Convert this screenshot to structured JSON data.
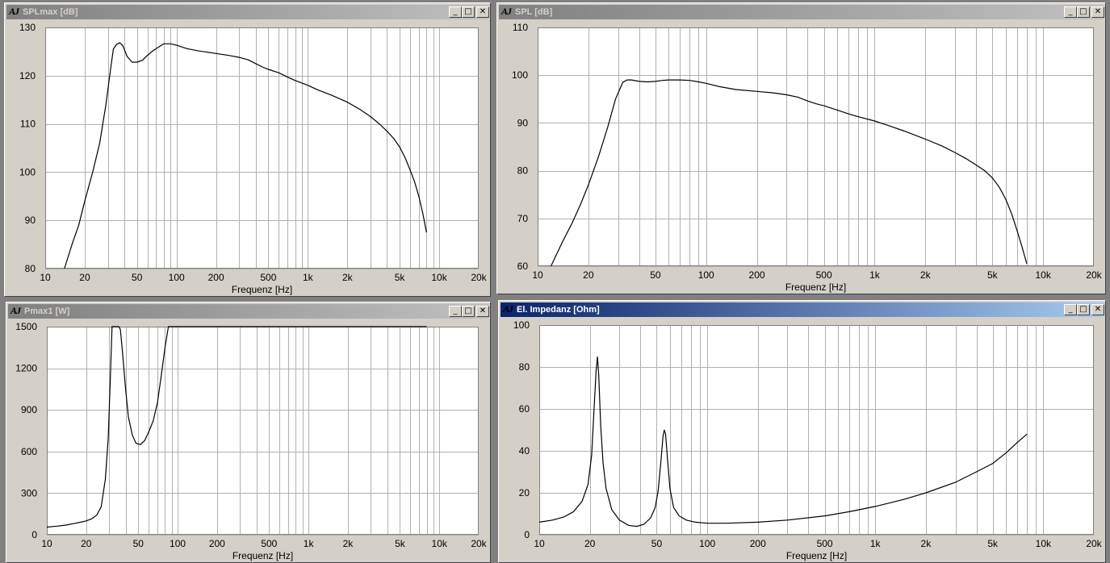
{
  "windows": [
    {
      "id": "splmax",
      "title": "SPLmax [dB]",
      "active": false,
      "buttons": {
        "minimize": "_",
        "maximize": "□",
        "close": "✕"
      },
      "chart_data": {
        "type": "line",
        "xscale": "log",
        "xlim": [
          10,
          20000
        ],
        "ylim": [
          80,
          130
        ],
        "xticks": [
          10,
          20,
          50,
          100,
          200,
          500,
          1000,
          2000,
          5000,
          10000,
          20000
        ],
        "xtick_labels": [
          "10",
          "20",
          "50",
          "100",
          "200",
          "500",
          "1k",
          "2k",
          "5k",
          "10k",
          "20k"
        ],
        "yticks": [
          80,
          90,
          100,
          110,
          120,
          130
        ],
        "ytick_labels": [
          "80",
          "90",
          "100",
          "110",
          "120",
          "130"
        ],
        "xlabel": "Frequenz [Hz]",
        "ylabel": "",
        "grid": true,
        "series": [
          {
            "x": [
              14,
              16,
              18,
              20,
              23,
              26,
              29,
              31,
              33,
              35,
              37,
              39,
              42,
              46,
              50,
              55,
              60,
              65,
              70,
              80,
              90,
              100,
              120,
              150,
              200,
              250,
              300,
              350,
              400,
              450,
              500,
              600,
              700,
              800,
              1000,
              1200,
              1500,
              2000,
              2500,
              3000,
              3500,
              4000,
              4500,
              5000,
              5500,
              6000,
              6500,
              7000,
              7500,
              8000
            ],
            "y": [
              80,
              85,
              89,
              94,
              100,
              106,
              114,
              120,
              125.5,
              126.5,
              126.8,
              126.2,
              124,
              122.8,
              122.8,
              123.2,
              124.2,
              125,
              125.6,
              126.6,
              126.6,
              126.3,
              125.6,
              125.1,
              124.6,
              124.2,
              123.8,
              123.3,
              122.5,
              121.8,
              121.3,
              120.6,
              119.7,
              119,
              118,
              117,
              116,
              114.5,
              113,
              111.5,
              110,
              108.5,
              107,
              105.2,
              103,
              100.5,
              98,
              95,
              91.5,
              87.5
            ]
          }
        ]
      }
    },
    {
      "id": "spl",
      "title": "SPL [dB]",
      "active": false,
      "buttons": {
        "minimize": "_",
        "maximize": "□",
        "close": "✕"
      },
      "chart_data": {
        "type": "line",
        "xscale": "log",
        "xlim": [
          10,
          20000
        ],
        "ylim": [
          60,
          110
        ],
        "xticks": [
          10,
          20,
          50,
          100,
          200,
          500,
          1000,
          2000,
          5000,
          10000,
          20000
        ],
        "xtick_labels": [
          "10",
          "20",
          "50",
          "100",
          "200",
          "500",
          "1k",
          "2k",
          "5k",
          "10k",
          "20k"
        ],
        "yticks": [
          60,
          70,
          80,
          90,
          100,
          110
        ],
        "ytick_labels": [
          "60",
          "70",
          "80",
          "90",
          "100",
          "110"
        ],
        "xlabel": "Frequenz [Hz]",
        "ylabel": "",
        "grid": true,
        "series": [
          {
            "x": [
              12,
              14,
              16,
              18,
              20,
              23,
              26,
              29,
              32,
              34,
              36,
              40,
              45,
              50,
              55,
              60,
              70,
              80,
              90,
              100,
              120,
              150,
              200,
              250,
              300,
              350,
              400,
              450,
              500,
              600,
              700,
              800,
              1000,
              1200,
              1500,
              2000,
              2500,
              3000,
              3500,
              4000,
              4500,
              5000,
              5500,
              6000,
              6500,
              7000,
              7500,
              8000
            ],
            "y": [
              60,
              65,
              69,
              73,
              77,
              83,
              89,
              95,
              98.5,
              99,
              99,
              98.7,
              98.6,
              98.7,
              98.9,
              99,
              99,
              98.9,
              98.6,
              98.3,
              97.6,
              97,
              96.6,
              96.3,
              95.9,
              95.4,
              94.6,
              94,
              93.6,
              92.7,
              91.9,
              91.3,
              90.4,
              89.5,
              88.3,
              86.6,
              85.2,
              83.8,
              82.5,
              81.2,
              80,
              78.5,
              76.5,
              74,
              71,
              67.5,
              64,
              60.5
            ]
          }
        ]
      }
    },
    {
      "id": "pmax",
      "title": "Pmax1 [W]",
      "active": false,
      "buttons": {
        "minimize": "_",
        "maximize": "□",
        "close": "✕"
      },
      "chart_data": {
        "type": "line",
        "xscale": "log",
        "xlim": [
          10,
          20000
        ],
        "ylim": [
          0,
          1500
        ],
        "xticks": [
          10,
          20,
          50,
          100,
          200,
          500,
          1000,
          2000,
          5000,
          10000,
          20000
        ],
        "xtick_labels": [
          "10",
          "20",
          "50",
          "100",
          "200",
          "500",
          "1k",
          "2k",
          "5k",
          "10k",
          "20k"
        ],
        "yticks": [
          0,
          300,
          600,
          900,
          1200,
          1500
        ],
        "ytick_labels": [
          "0",
          "300",
          "600",
          "900",
          "1200",
          "1500"
        ],
        "xlabel": "Frequenz [Hz]",
        "ylabel": "",
        "grid": true,
        "series": [
          {
            "x": [
              10,
              12,
              14,
              16,
              18,
              20,
              22,
              24,
              26,
              28,
              29.5,
              30.5,
              31.5,
              32.5,
              33.5,
              34.5,
              35.5,
              36.5,
              38,
              40,
              42,
              45,
              48,
              52,
              56,
              60,
              65,
              70,
              75,
              80,
              85,
              90,
              100,
              200,
              500,
              1000,
              2000,
              5000,
              8000
            ],
            "y": [
              55,
              62,
              70,
              80,
              90,
              100,
              115,
              140,
              200,
              400,
              700,
              1100,
              1500,
              1500,
              1500,
              1500,
              1500,
              1480,
              1300,
              1050,
              850,
              720,
              660,
              650,
              680,
              740,
              820,
              950,
              1150,
              1350,
              1500,
              1500,
              1500,
              1500,
              1500,
              1500,
              1500,
              1500,
              1500
            ]
          }
        ]
      }
    },
    {
      "id": "impedance",
      "title": "El. Impedanz [Ohm]",
      "active": true,
      "buttons": {
        "minimize": "_",
        "maximize": "□",
        "close": "✕"
      },
      "chart_data": {
        "type": "line",
        "xscale": "log",
        "xlim": [
          10,
          20000
        ],
        "ylim": [
          0,
          100
        ],
        "xticks": [
          10,
          20,
          50,
          100,
          200,
          500,
          1000,
          2000,
          5000,
          10000,
          20000
        ],
        "xtick_labels": [
          "10",
          "20",
          "50",
          "100",
          "200",
          "500",
          "1k",
          "2k",
          "5k",
          "10k",
          "20k"
        ],
        "yticks": [
          0,
          20,
          40,
          60,
          80,
          100
        ],
        "ytick_labels": [
          "0",
          "20",
          "40",
          "60",
          "80",
          "100"
        ],
        "xlabel": "Frequenz [Hz]",
        "ylabel": "",
        "grid": true,
        "series": [
          {
            "x": [
              10,
              12,
              14,
              16,
              18,
              19.5,
              20.5,
              21.2,
              21.8,
              22.2,
              22.6,
              23.2,
              24,
              25,
              27,
              30,
              34,
              38,
              42,
              46,
              49,
              51,
              53,
              54.5,
              55.5,
              56.5,
              58,
              60,
              63,
              68,
              75,
              85,
              100,
              130,
              200,
              300,
              500,
              700,
              1000,
              1500,
              2000,
              3000,
              4000,
              5000,
              6000,
              7000,
              8000
            ],
            "y": [
              6,
              7,
              8.5,
              11,
              16,
              24,
              38,
              60,
              78,
              85,
              76,
              52,
              34,
              22,
              12,
              7,
              4.5,
              4,
              5,
              8,
              13,
              21,
              35,
              47,
              50,
              48,
              36,
              22,
              13,
              9,
              7,
              6,
              5.5,
              5.5,
              6,
              7,
              9,
              11,
              13.5,
              17,
              20,
              25,
              30,
              34,
              39,
              44,
              48
            ]
          }
        ]
      }
    }
  ]
}
